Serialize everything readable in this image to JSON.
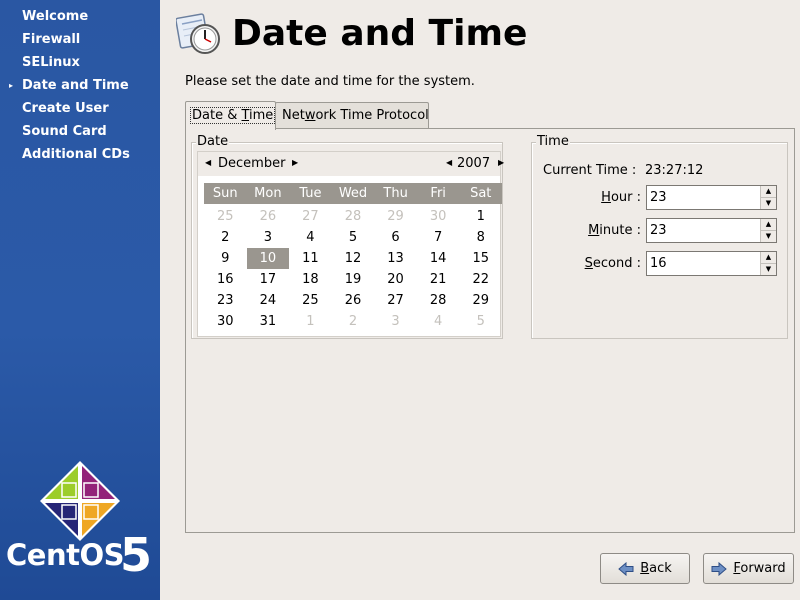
{
  "sidebar": {
    "steps": [
      "Welcome",
      "Firewall",
      "SELinux",
      "Date and Time",
      "Create User",
      "Sound Card",
      "Additional CDs"
    ],
    "current_index": 3,
    "current_marker": "▸",
    "logo_text": "CentOS",
    "logo_number": "5"
  },
  "header": {
    "title": "Date and Time",
    "icon": "clock-calendar-icon"
  },
  "instructions": "Please set the date and time for the system.",
  "tabs": [
    {
      "label_pre": "Date & ",
      "label_mnemonic": "T",
      "label_post": "ime",
      "active": true
    },
    {
      "label_pre": "Net",
      "label_mnemonic": "w",
      "label_post": "ork Time Protocol",
      "active": false
    }
  ],
  "date_frame": {
    "label": "Date",
    "month": "December",
    "year": "2007",
    "weekdays": [
      "Sun",
      "Mon",
      "Tue",
      "Wed",
      "Thu",
      "Fri",
      "Sat"
    ],
    "days": [
      {
        "d": "25",
        "other": true
      },
      {
        "d": "26",
        "other": true
      },
      {
        "d": "27",
        "other": true
      },
      {
        "d": "28",
        "other": true
      },
      {
        "d": "29",
        "other": true
      },
      {
        "d": "30",
        "other": true
      },
      {
        "d": "1"
      },
      {
        "d": "2"
      },
      {
        "d": "3"
      },
      {
        "d": "4"
      },
      {
        "d": "5"
      },
      {
        "d": "6"
      },
      {
        "d": "7"
      },
      {
        "d": "8"
      },
      {
        "d": "9"
      },
      {
        "d": "10",
        "selected": true
      },
      {
        "d": "11"
      },
      {
        "d": "12"
      },
      {
        "d": "13"
      },
      {
        "d": "14"
      },
      {
        "d": "15"
      },
      {
        "d": "16"
      },
      {
        "d": "17"
      },
      {
        "d": "18"
      },
      {
        "d": "19"
      },
      {
        "d": "20"
      },
      {
        "d": "21"
      },
      {
        "d": "22"
      },
      {
        "d": "23"
      },
      {
        "d": "24"
      },
      {
        "d": "25"
      },
      {
        "d": "26"
      },
      {
        "d": "27"
      },
      {
        "d": "28"
      },
      {
        "d": "29"
      },
      {
        "d": "30"
      },
      {
        "d": "31"
      },
      {
        "d": "1",
        "other": true
      },
      {
        "d": "2",
        "other": true
      },
      {
        "d": "3",
        "other": true
      },
      {
        "d": "4",
        "other": true
      },
      {
        "d": "5",
        "other": true
      }
    ]
  },
  "time_frame": {
    "label": "Time",
    "current_time_label": "Current Time :",
    "current_time_value": "23:27:12",
    "hour": {
      "mnemonic": "H",
      "rest": "our :",
      "value": "23"
    },
    "minute": {
      "mnemonic": "M",
      "rest": "inute :",
      "value": "23"
    },
    "second": {
      "mnemonic": "S",
      "rest": "econd :",
      "value": "16"
    }
  },
  "buttons": {
    "back": {
      "mnemonic": "B",
      "rest": "ack"
    },
    "forward": {
      "mnemonic": "F",
      "rest": "orward"
    }
  },
  "colors": {
    "sidebar_blue": "#2b5aa8",
    "window_bg": "#efebe7",
    "selection_gray": "#9a968f"
  }
}
